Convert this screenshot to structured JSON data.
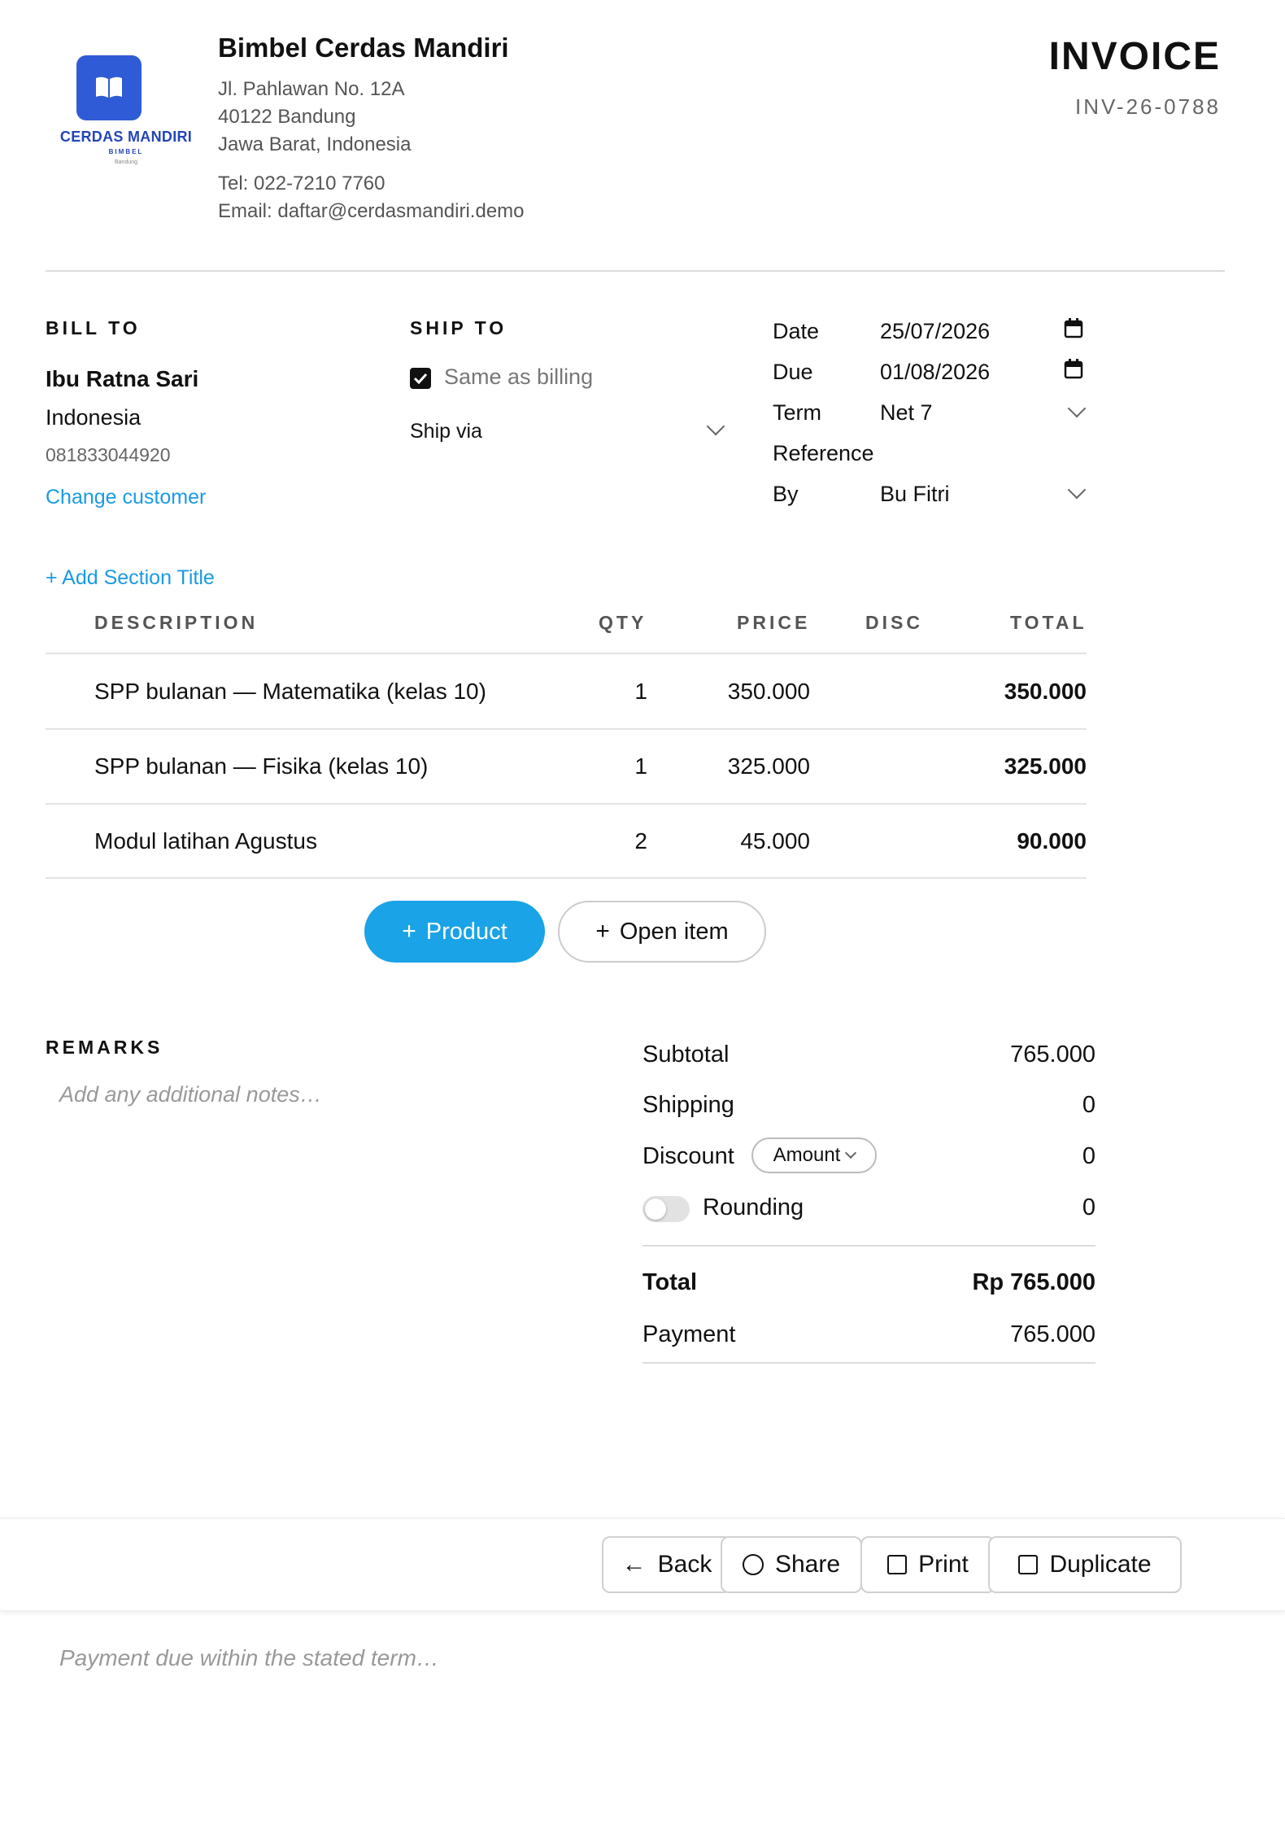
{
  "company": {
    "logo_name": "CERDAS MANDIRI",
    "logo_sub": "BIMBEL",
    "logo_city": "Bandung",
    "name": "Bimbel Cerdas Mandiri",
    "address1": "Jl. Pahlawan No. 12A",
    "address2": "40122 Bandung",
    "address3": "Jawa Barat, Indonesia",
    "tel": "Tel: 022-7210 7760",
    "email": "Email: daftar@cerdasmandiri.demo"
  },
  "invoice": {
    "title": "INVOICE",
    "number": "INV-26-0788"
  },
  "bill_to": {
    "label": "BILL TO",
    "name": "Ibu Ratna Sari",
    "country": "Indonesia",
    "phone": "081833044920",
    "change_link": "Change customer"
  },
  "ship_to": {
    "label": "SHIP TO",
    "same_as_billing": "Same as billing",
    "same_checked": true,
    "ship_via": "Ship via"
  },
  "meta": {
    "date_label": "Date",
    "date_value": "25/07/2026",
    "due_label": "Due",
    "due_value": "01/08/2026",
    "term_label": "Term",
    "term_value": "Net 7",
    "reference_label": "Reference",
    "by_label": "By",
    "by_value": "Bu Fitri"
  },
  "add_section": "+ Add Section Title",
  "table": {
    "headers": {
      "description": "DESCRIPTION",
      "qty": "QTY",
      "price": "PRICE",
      "disc": "DISC",
      "total": "TOTAL"
    },
    "rows": [
      {
        "description": "SPP bulanan — Matematika (kelas 10)",
        "qty": "1",
        "price": "350.000",
        "disc": "",
        "total": "350.000"
      },
      {
        "description": "SPP bulanan — Fisika (kelas 10)",
        "qty": "1",
        "price": "325.000",
        "disc": "",
        "total": "325.000"
      },
      {
        "description": "Modul latihan Agustus",
        "qty": "2",
        "price": "45.000",
        "disc": "",
        "total": "90.000"
      }
    ]
  },
  "buttons": {
    "product": "Product",
    "open_item": "Open item"
  },
  "remarks": {
    "label": "REMARKS",
    "placeholder": "Add any additional notes…"
  },
  "summary": {
    "subtotal_label": "Subtotal",
    "subtotal_value": "765.000",
    "shipping_label": "Shipping",
    "shipping_value": "0",
    "discount_label": "Discount",
    "discount_mode": "Amount",
    "discount_value": "0",
    "rounding_label": "Rounding",
    "rounding_on": false,
    "rounding_value": "0",
    "total_label": "Total",
    "total_value": "Rp 765.000",
    "payment_label": "Payment",
    "payment_value": "765.000"
  },
  "actions": {
    "back": "Back",
    "share": "Share",
    "print": "Print",
    "duplicate": "Duplicate"
  },
  "footer_placeholder": "Payment due within the stated term…",
  "colors": {
    "accent": "#1aa3e6",
    "brand": "#2f5bd6"
  }
}
